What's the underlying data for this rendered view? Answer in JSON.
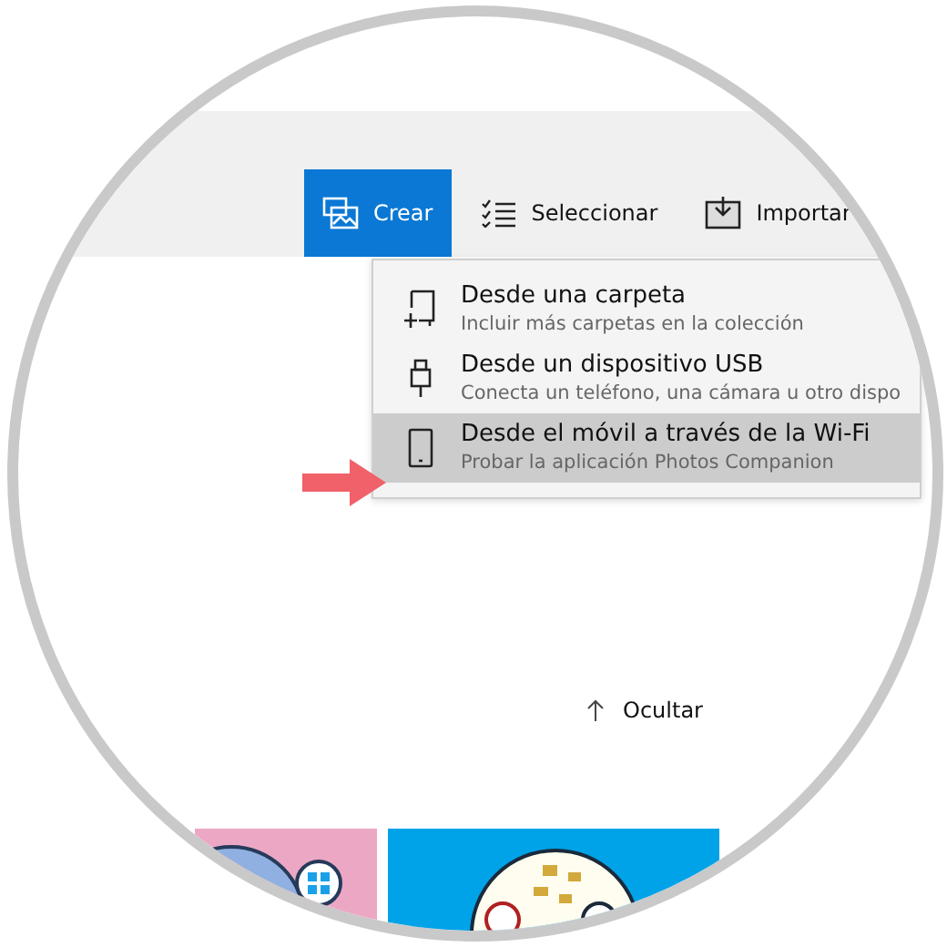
{
  "toolbar": {
    "buttons": [
      {
        "label": "Crear",
        "selected": true
      },
      {
        "label": "Seleccionar",
        "selected": false
      },
      {
        "label": "Importar",
        "selected": false
      }
    ]
  },
  "menu": {
    "items": [
      {
        "title": "Desde una carpeta",
        "subtitle": "Incluir más carpetas en la colección",
        "selected": false
      },
      {
        "title": "Desde un dispositivo USB",
        "subtitle": "Conecta un teléfono, una cámara u otro dispo",
        "selected": false
      },
      {
        "title": "Desde el móvil a través de la Wi-Fi",
        "subtitle": "Probar la aplicación Photos Companion",
        "selected": true
      }
    ]
  },
  "hide_link": {
    "label": "Ocultar"
  }
}
